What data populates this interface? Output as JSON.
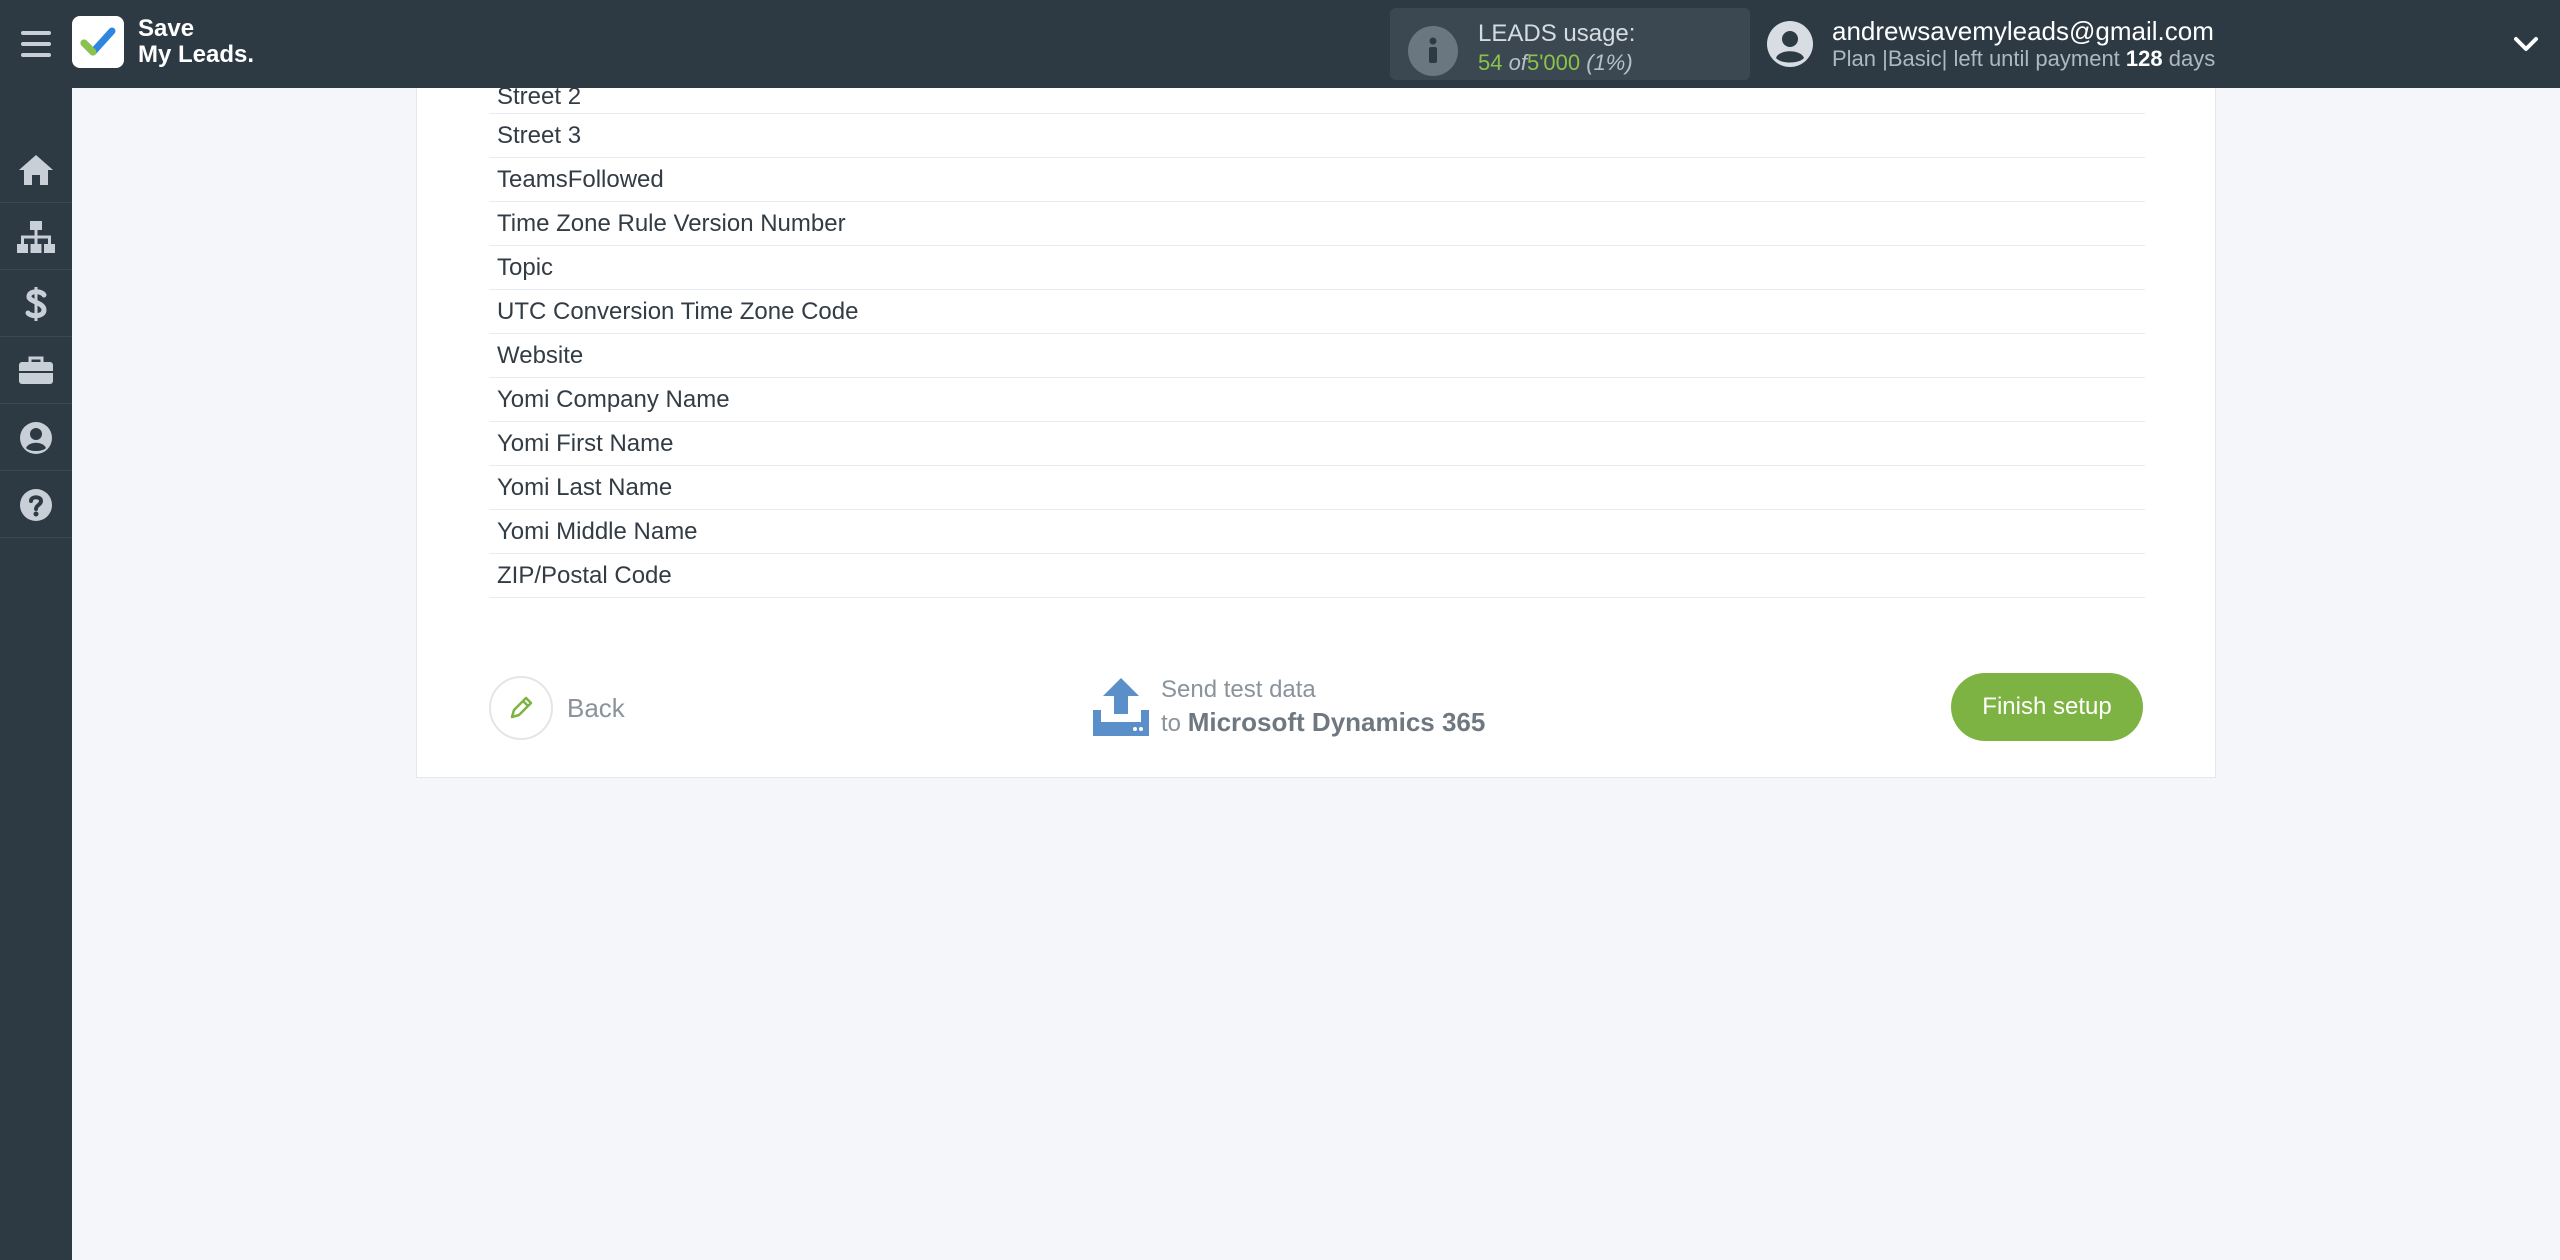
{
  "header": {
    "logo_line1": "Save",
    "logo_line2": "My Leads.",
    "leads_title": "LEADS usage:",
    "leads_used": "54",
    "leads_of": "of",
    "leads_total": "5'000",
    "leads_percent": "(1%)",
    "user_email": "andrewsavemyleads@gmail.com",
    "plan_prefix": "Plan |",
    "plan_name": "Basic",
    "plan_middle": "| left until payment",
    "plan_days": "128",
    "plan_suffix": "days"
  },
  "sidebar": {
    "items": [
      {
        "name": "home",
        "icon": "home-icon"
      },
      {
        "name": "connections",
        "icon": "sitemap-icon"
      },
      {
        "name": "billing",
        "icon": "dollar-icon"
      },
      {
        "name": "tools",
        "icon": "briefcase-icon"
      },
      {
        "name": "account",
        "icon": "user-circle-icon"
      },
      {
        "name": "help",
        "icon": "question-circle-icon"
      }
    ]
  },
  "fields": [
    "Street 2",
    "Street 3",
    "TeamsFollowed",
    "Time Zone Rule Version Number",
    "Topic",
    "UTC Conversion Time Zone Code",
    "Website",
    "Yomi Company Name",
    "Yomi First Name",
    "Yomi Last Name",
    "Yomi Middle Name",
    "ZIP/Postal Code"
  ],
  "actions": {
    "back_label": "Back",
    "send_line1": "Send test data",
    "send_to": "to",
    "send_target": "Microsoft Dynamics 365",
    "finish_label": "Finish setup"
  },
  "colors": {
    "topbar": "#2d3a44",
    "accent_green": "#7cb342",
    "upload_blue": "#5b8fc9"
  }
}
